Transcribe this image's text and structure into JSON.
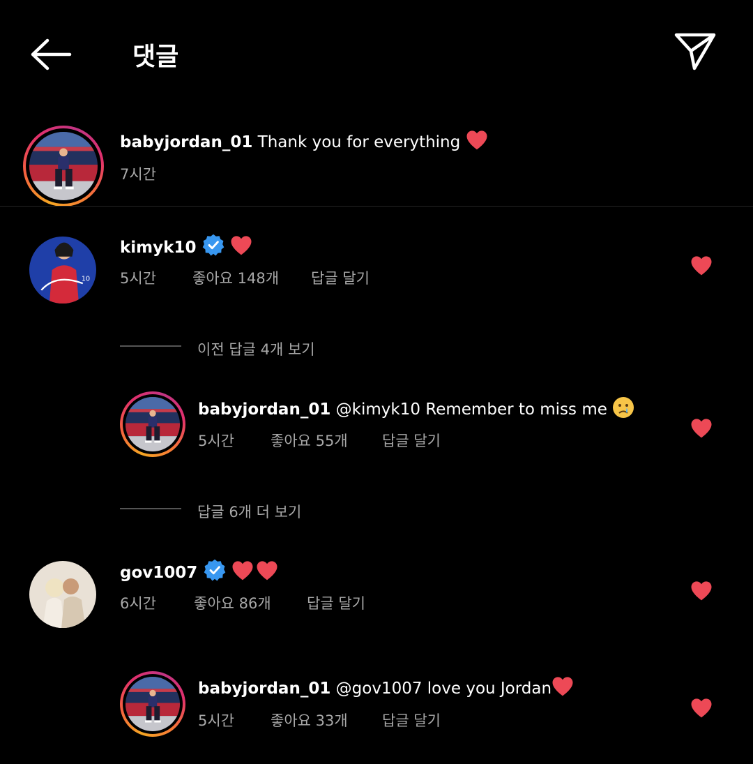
{
  "header": {
    "title": "댓글"
  },
  "caption": {
    "username": "babyjordan_01",
    "text": "Thank you for everything",
    "time": "7시간"
  },
  "comments": [
    {
      "username": "kimyk10",
      "verified": true,
      "text": "",
      "time": "5시간",
      "likes": "좋아요 148개",
      "reply": "답글 달기"
    },
    {
      "username": "babyjordan_01",
      "mention": "@kimyk10",
      "text": "Remember to miss me",
      "time": "5시간",
      "likes": "좋아요 55개",
      "reply": "답글 달기"
    },
    {
      "username": "gov1007",
      "verified": true,
      "text": "",
      "time": "6시간",
      "likes": "좋아요 86개",
      "reply": "답글 달기"
    },
    {
      "username": "babyjordan_01",
      "mention": "@gov1007",
      "text": "love you Jordan",
      "time": "5시간",
      "likes": "좋아요 33개",
      "reply": "답글 달기"
    }
  ],
  "threads": {
    "view_previous": "이전 답글 4개 보기",
    "view_more": "답글 6개 더 보기"
  },
  "colors": {
    "background": "#000000",
    "heart": "#ed4956",
    "verified": "#3897f0",
    "meta_text": "#a8a8a8"
  },
  "icons": [
    "back-arrow-icon",
    "send-icon",
    "heart-icon",
    "verified-badge-icon",
    "crying-face-emoji"
  ]
}
